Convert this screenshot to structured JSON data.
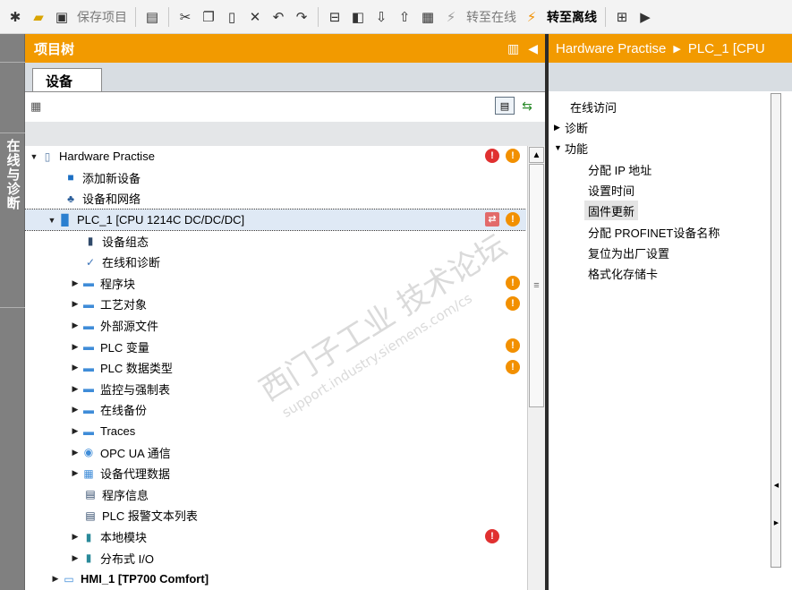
{
  "toolbar": {
    "save_project": "保存项目",
    "go_online": "转至在线",
    "go_offline": "转至离线"
  },
  "left_strip": {
    "tab_label": "在线与诊断"
  },
  "project_tree": {
    "title": "项目树",
    "tab": "设备",
    "rows": [
      {
        "label": "Hardware Practise"
      },
      {
        "label": "添加新设备"
      },
      {
        "label": "设备和网络"
      },
      {
        "label": "PLC_1 [CPU 1214C DC/DC/DC]"
      },
      {
        "label": "设备组态"
      },
      {
        "label": "在线和诊断"
      },
      {
        "label": "程序块"
      },
      {
        "label": "工艺对象"
      },
      {
        "label": "外部源文件"
      },
      {
        "label": "PLC 变量"
      },
      {
        "label": "PLC 数据类型"
      },
      {
        "label": "监控与强制表"
      },
      {
        "label": "在线备份"
      },
      {
        "label": "Traces"
      },
      {
        "label": "OPC UA 通信"
      },
      {
        "label": "设备代理数据"
      },
      {
        "label": "程序信息"
      },
      {
        "label": "PLC 报警文本列表"
      },
      {
        "label": "本地模块"
      },
      {
        "label": "分布式 I/O"
      },
      {
        "label": "HMI_1 [TP700 Comfort]"
      }
    ]
  },
  "right_panel": {
    "breadcrumb": [
      "Hardware Practise",
      "PLC_1 [CPU"
    ],
    "nav": [
      {
        "label": "在线访问"
      },
      {
        "label": "诊断"
      },
      {
        "label": "功能"
      },
      {
        "label": "分配 IP 地址"
      },
      {
        "label": "设置时间"
      },
      {
        "label": "固件更新"
      },
      {
        "label": "分配 PROFINET设备名称"
      },
      {
        "label": "复位为出厂设置"
      },
      {
        "label": "格式化存储卡"
      }
    ]
  },
  "watermark": {
    "line1": "西门子工业 技术论坛",
    "line2": "support.industry.siemens.com/cs"
  },
  "colors": {
    "header_orange": "#f29a00",
    "error_red": "#e03030",
    "warning_orange": "#f29000"
  }
}
